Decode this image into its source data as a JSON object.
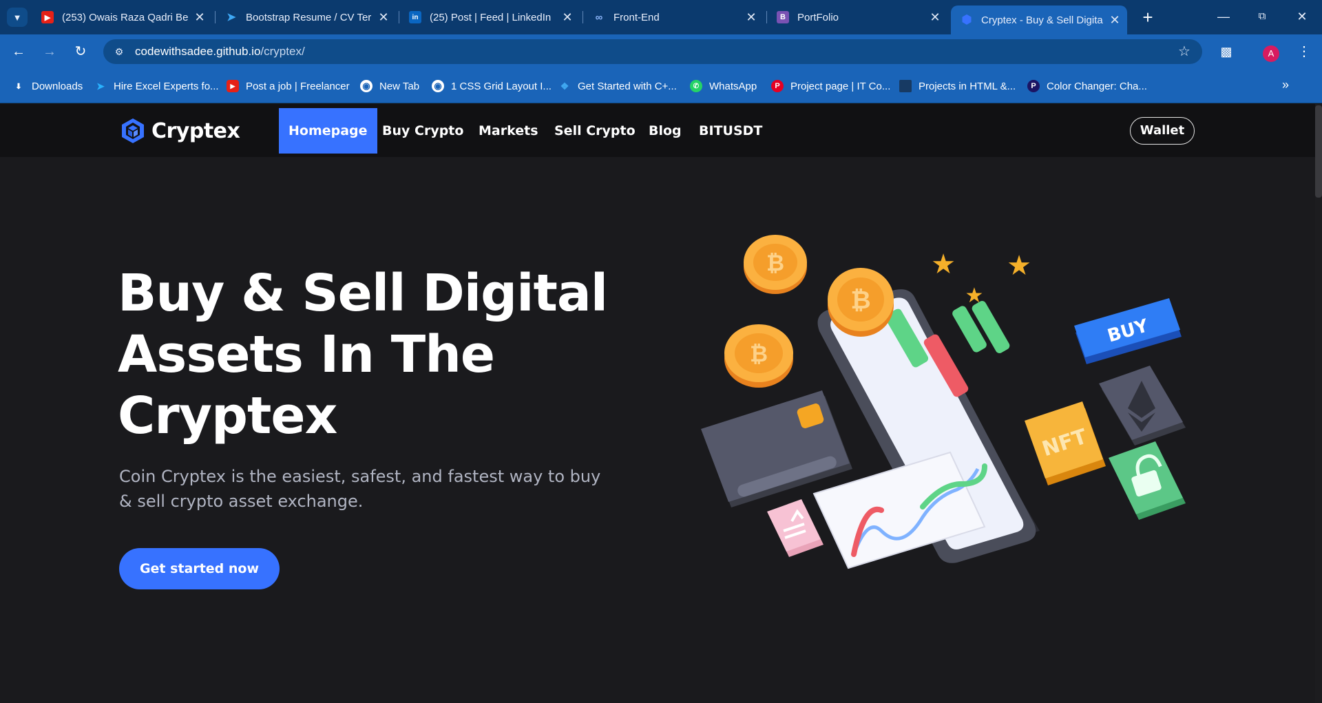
{
  "browser": {
    "tabs": [
      {
        "title": "(253) Owais Raza Qadri Be",
        "favicon": "youtube-icon",
        "active": false
      },
      {
        "title": "Bootstrap Resume / CV Ter",
        "favicon": "bootstrapmade-icon",
        "active": false
      },
      {
        "title": "(25) Post | Feed | LinkedIn",
        "favicon": "linkedin-icon",
        "active": false
      },
      {
        "title": "Front-End",
        "favicon": "frontend-icon",
        "active": false
      },
      {
        "title": "PortFolio",
        "favicon": "bootstrap-icon",
        "active": false
      },
      {
        "title": "Cryptex - Buy & Sell Digita",
        "favicon": "cryptex-icon",
        "active": true
      }
    ],
    "url": {
      "host": "codewithsadee.github.io",
      "path": "/cryptex/"
    },
    "avatar_letter": "A",
    "bookmarks": [
      {
        "label": "Downloads",
        "icon": "download-icon"
      },
      {
        "label": "Hire Excel Experts fo...",
        "icon": "freelancer-icon"
      },
      {
        "label": "Post a job | Freelancer",
        "icon": "youtube-icon"
      },
      {
        "label": "New Tab",
        "icon": "globe-icon"
      },
      {
        "label": "1 CSS Grid Layout I...",
        "icon": "globe-icon"
      },
      {
        "label": "Get Started with C+...",
        "icon": "vscode-icon"
      },
      {
        "label": "WhatsApp",
        "icon": "whatsapp-icon"
      },
      {
        "label": "Project page | IT Co...",
        "icon": "pinterest-icon"
      },
      {
        "label": "Projects in HTML &...",
        "icon": "page-icon"
      },
      {
        "label": "Color Changer: Cha...",
        "icon": "p-logo-icon"
      }
    ]
  },
  "site": {
    "brand": "Cryptex",
    "nav": [
      {
        "label": "Homepage",
        "active": true
      },
      {
        "label": "Buy Crypto",
        "active": false
      },
      {
        "label": "Markets",
        "active": false
      },
      {
        "label": "Sell Crypto",
        "active": false
      },
      {
        "label": "Blog",
        "active": false
      },
      {
        "label": "BITUSDT",
        "active": false
      }
    ],
    "wallet_label": "Wallet",
    "hero": {
      "title_lines": [
        "Buy & Sell Digital",
        "Assets In The",
        "Cryptex"
      ],
      "subtitle": "Coin Cryptex is the easiest, safest, and fastest way to buy & sell crypto asset exchange.",
      "cta_label": "Get started now"
    },
    "illustration": {
      "buy_label": "BUY",
      "nft_label": "NFT"
    },
    "colors": {
      "accent": "#3772ff",
      "background": "#1a1a1d",
      "nav_background": "#111113",
      "subtitle": "#b1b5c3"
    }
  }
}
